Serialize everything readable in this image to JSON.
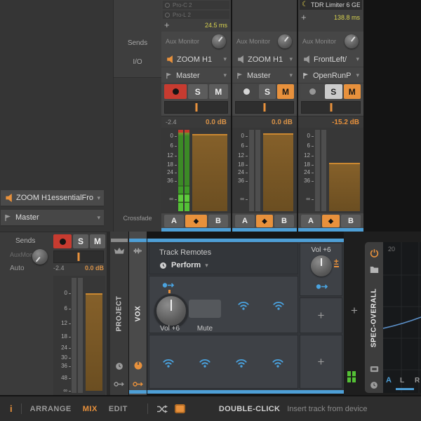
{
  "colors": {
    "orange": "#e8913c",
    "blue": "#4e9fd6",
    "yellow": "#d9d34f",
    "red": "#c73b30",
    "green": "#54c136",
    "brown": "#7d5a28"
  },
  "left_panel": {
    "sends": "Sends",
    "io": "I/O",
    "crossfade": "Crossfade",
    "ab": "AB"
  },
  "strips": [
    {
      "devices": [
        "Pro-C 2",
        "Pro-L 2"
      ],
      "add": "+",
      "latency": "24.5 ms",
      "aux": "Aux Monitor",
      "input": "ZOOM H1",
      "output": "Master",
      "solo": "S",
      "mute": "M",
      "peak": "-2.4",
      "fader": "0.0 dB",
      "scale": [
        "0",
        "6",
        "12",
        "18",
        "24",
        "36",
        "∞"
      ],
      "a": "A",
      "b": "B"
    },
    {
      "aux": "Aux Monitor",
      "input": "ZOOM H1",
      "output": "Master",
      "solo": "S",
      "mute": "M",
      "peak": "",
      "fader": "0.0 dB",
      "scale": [
        "0",
        "6",
        "12",
        "18",
        "24",
        "36",
        "∞"
      ],
      "a": "A",
      "b": "B"
    },
    {
      "device": "TDR Limiter 6 GE",
      "add": "+",
      "latency": "138.8 ms",
      "aux": "Aux Monitor",
      "input": "FrontLeft/",
      "output": "OpenRunP",
      "solo": "S",
      "mute": "M",
      "peak": "",
      "fader": "-15.2 dB",
      "scale": [
        "0",
        "6",
        "12",
        "18",
        "24",
        "36",
        "∞"
      ],
      "a": "A",
      "b": "B"
    }
  ],
  "left_channel": {
    "input": "ZOOM H1essentialFron",
    "output": "Master",
    "sends": "Sends",
    "aux_name": "AuxMoni",
    "auto": "Auto",
    "solo": "S",
    "mute": "M",
    "peak": "-2.4",
    "fader": "0.0 dB",
    "scale": [
      "0",
      "6",
      "12",
      "18",
      "24",
      "30",
      "36",
      "48",
      "∞"
    ]
  },
  "device_panel": {
    "project_tab": "PROJECT",
    "track_tab": "VOX",
    "title": "Track Remotes",
    "page": "Perform",
    "knob_label": "Vol +6",
    "mute_label": "Mute",
    "side_knob_label": "Vol +6",
    "add_slot": "+",
    "add_slot2": "+",
    "add_device": "+"
  },
  "spectrum": {
    "title": "SPEC-OVERALL",
    "corner": "20",
    "ch_a": "A",
    "ch_l": "L",
    "ch_r": "R"
  },
  "status_bar": {
    "info": "i",
    "arrange": "ARRANGE",
    "mix": "MIX",
    "edit": "EDIT",
    "hint_key": "DOUBLE-CLICK",
    "hint": "Insert track from device"
  }
}
